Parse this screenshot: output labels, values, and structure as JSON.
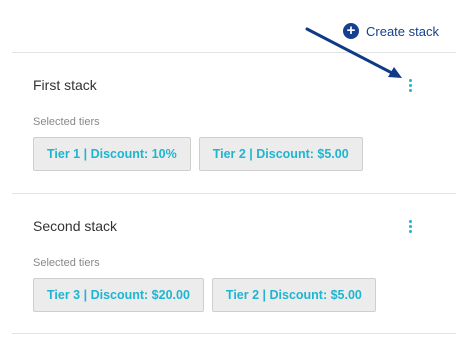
{
  "colors": {
    "accent": "#1eb5d1",
    "brand": "#153f8f",
    "arrow": "#0e3a86"
  },
  "header": {
    "create_stack_label": "Create stack",
    "create_stack_icon": "plus-circle-icon"
  },
  "stacks": [
    {
      "title": "First stack",
      "tiers_label": "Selected tiers",
      "menu_icon": "kebab-menu-icon",
      "tiers": [
        "Tier 1 | Discount: 10%",
        "Tier 2 | Discount: $5.00"
      ]
    },
    {
      "title": "Second stack",
      "tiers_label": "Selected tiers",
      "menu_icon": "kebab-menu-icon",
      "tiers": [
        "Tier 3 | Discount: $20.00",
        "Tier 2 | Discount: $5.00"
      ]
    }
  ]
}
